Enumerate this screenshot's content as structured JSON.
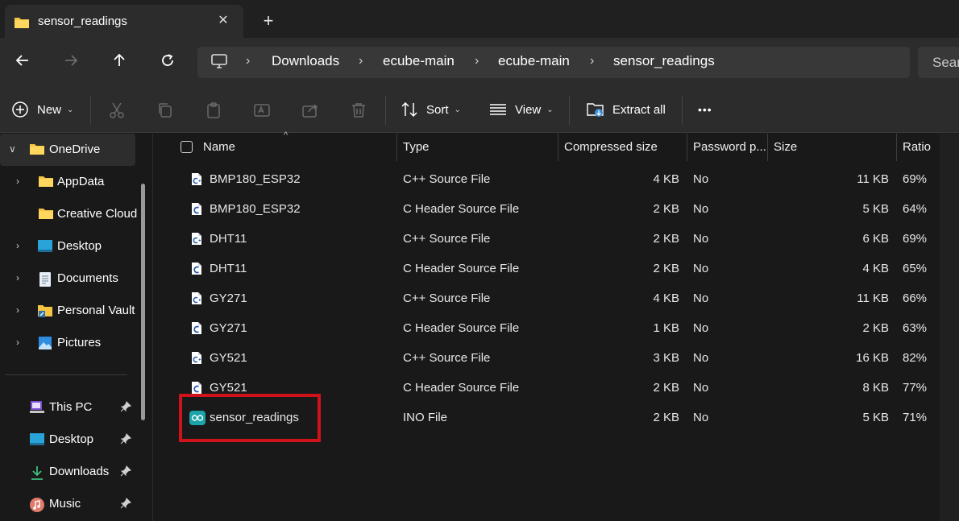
{
  "tab": {
    "title": "sensor_readings",
    "close": "✕",
    "new_tab": "+"
  },
  "nav": {
    "breadcrumbs": [
      "Downloads",
      "ecube-main",
      "ecube-main",
      "sensor_readings"
    ],
    "search_placeholder": "Search sensor_readings"
  },
  "commands": {
    "new": "New",
    "sort": "Sort",
    "view": "View",
    "extract_all": "Extract all",
    "more": "•••"
  },
  "sidebar": {
    "onedrive": "OneDrive",
    "items": [
      "AppData",
      "Creative Cloud",
      "Desktop",
      "Documents",
      "Personal Vault",
      "Pictures"
    ],
    "quick": [
      "This PC",
      "Desktop",
      "Downloads",
      "Music"
    ]
  },
  "columns": {
    "name": "Name",
    "type": "Type",
    "compressed": "Compressed size",
    "password": "Password p...",
    "size": "Size",
    "ratio": "Ratio"
  },
  "files": [
    {
      "name": "BMP180_ESP32",
      "kind": "cpp",
      "type": "C++ Source File",
      "compressed": "4 KB",
      "password": "No",
      "size": "11 KB",
      "ratio": "69%"
    },
    {
      "name": "BMP180_ESP32",
      "kind": "h",
      "type": "C Header Source File",
      "compressed": "2 KB",
      "password": "No",
      "size": "5 KB",
      "ratio": "64%"
    },
    {
      "name": "DHT11",
      "kind": "cpp",
      "type": "C++ Source File",
      "compressed": "2 KB",
      "password": "No",
      "size": "6 KB",
      "ratio": "69%"
    },
    {
      "name": "DHT11",
      "kind": "h",
      "type": "C Header Source File",
      "compressed": "2 KB",
      "password": "No",
      "size": "4 KB",
      "ratio": "65%"
    },
    {
      "name": "GY271",
      "kind": "cpp",
      "type": "C++ Source File",
      "compressed": "4 KB",
      "password": "No",
      "size": "11 KB",
      "ratio": "66%"
    },
    {
      "name": "GY271",
      "kind": "h",
      "type": "C Header Source File",
      "compressed": "1 KB",
      "password": "No",
      "size": "2 KB",
      "ratio": "63%"
    },
    {
      "name": "GY521",
      "kind": "cpp",
      "type": "C++ Source File",
      "compressed": "3 KB",
      "password": "No",
      "size": "16 KB",
      "ratio": "82%"
    },
    {
      "name": "GY521",
      "kind": "h",
      "type": "C Header Source File",
      "compressed": "2 KB",
      "password": "No",
      "size": "8 KB",
      "ratio": "77%"
    },
    {
      "name": "sensor_readings",
      "kind": "ino",
      "type": "INO File",
      "compressed": "2 KB",
      "password": "No",
      "size": "5 KB",
      "ratio": "71%"
    }
  ],
  "colors": {
    "highlight": "#d0121b",
    "folder": "#f6c443",
    "arduino": "#1aa3a8"
  }
}
